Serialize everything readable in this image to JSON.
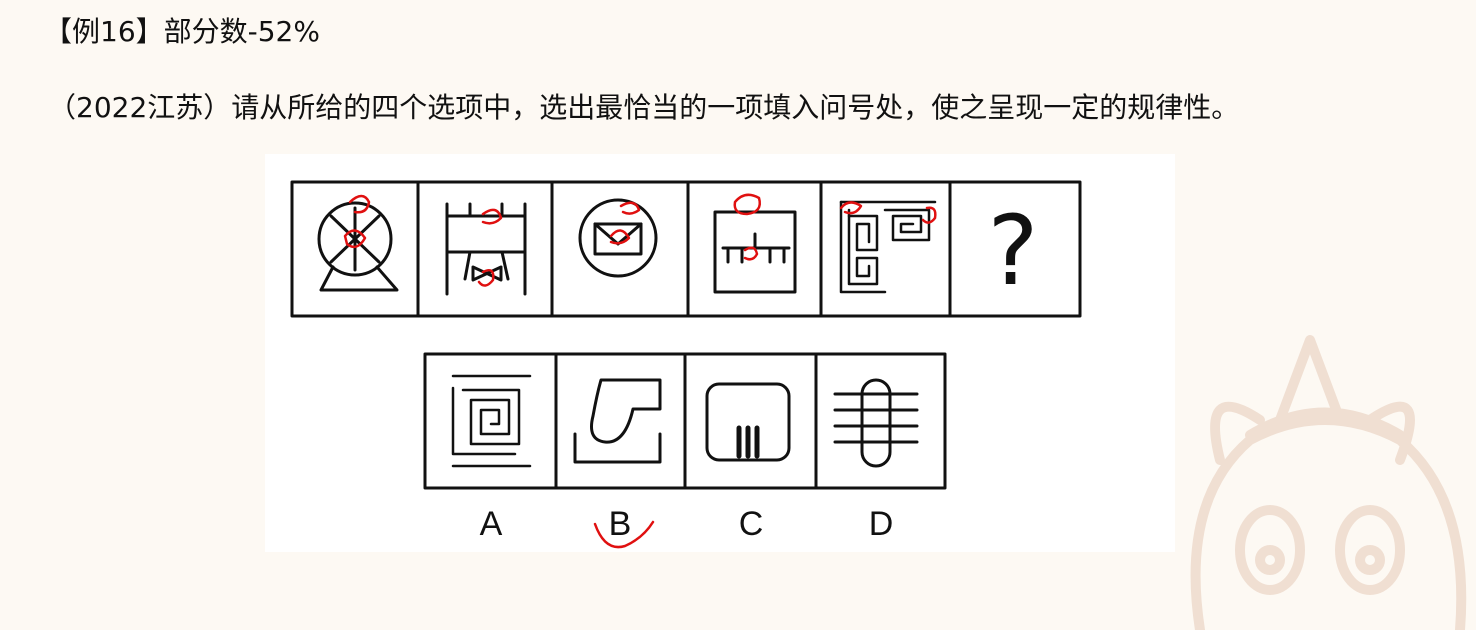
{
  "header": {
    "title": "【例16】部分数-52%"
  },
  "question": {
    "text": "（2022江苏）请从所给的四个选项中，选出最恰当的一项填入问号处，使之呈现一定的规律性。"
  },
  "puzzle": {
    "question_mark": "?",
    "options": [
      {
        "label": "A"
      },
      {
        "label": "B"
      },
      {
        "label": "C"
      },
      {
        "label": "D"
      }
    ]
  },
  "icons": {
    "watermark": "cartoon-mascot-watermark-icon",
    "figures": [
      "ferris-wheel-icon",
      "swing-bench-icon",
      "envelope-circle-icon",
      "table-frame-icon",
      "greek-key-pattern-icon",
      "question-mark-icon"
    ],
    "options": [
      "spiral-square-icon",
      "pipe-shape-icon",
      "tv-set-icon",
      "capsule-lines-icon"
    ]
  },
  "colors": {
    "background": "#fdf9f3",
    "ink": "#111111",
    "annotation": "#e01010",
    "watermark": "#f1e2d6"
  }
}
